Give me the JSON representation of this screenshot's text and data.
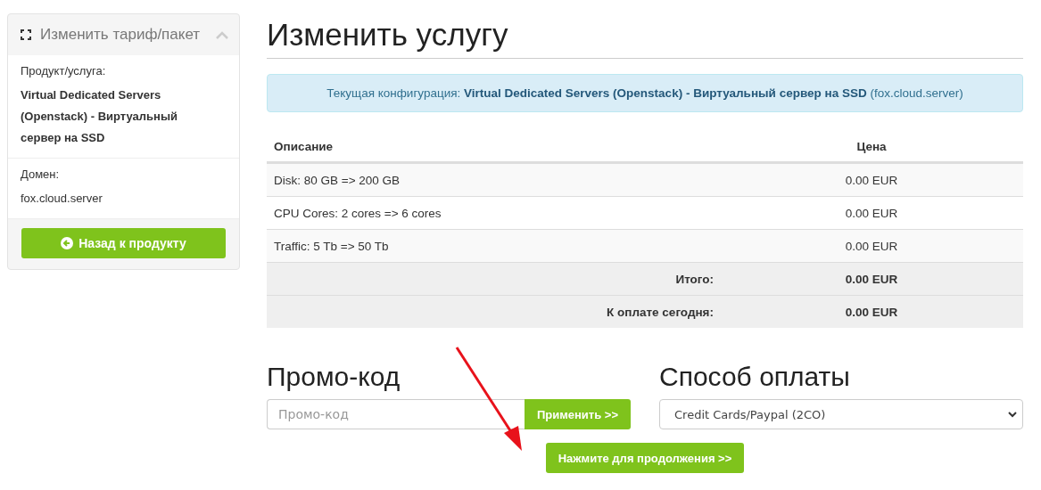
{
  "sidebar": {
    "title": "Изменить тариф/пакет",
    "expanded": true,
    "sections": [
      {
        "label": "Продукт/услуга:",
        "value": "Virtual Dedicated Servers (Openstack) - Виртуальный сервер на SSD",
        "bold": true
      },
      {
        "label": "Домен:",
        "value": "fox.cloud.server",
        "bold": false
      }
    ],
    "back_button": "Назад к продукту"
  },
  "title": "Изменить услугу",
  "alert": "Текущая конфигурация: **Virtual Dedicated Servers (Openstack) - Виртуальный сервер на SSD** (fox.cloud.server)",
  "table": {
    "columns": [
      "Описание",
      "Цена"
    ],
    "rows": [
      {
        "kind": "item",
        "description": "Disk: 80 GB => 200 GB",
        "price": "0.00 EUR"
      },
      {
        "kind": "item",
        "description": "CPU Cores: 2 cores => 6 cores",
        "price": "0.00 EUR"
      },
      {
        "kind": "item",
        "description": "Traffic: 5 Tb => 50 Tb",
        "price": "0.00 EUR"
      },
      {
        "kind": "total",
        "description": "Итого:",
        "price": "0.00 EUR"
      },
      {
        "kind": "total",
        "description": "К оплате сегодня:",
        "price": "0.00 EUR"
      }
    ]
  },
  "promo": {
    "heading": "Промо-код",
    "placeholder": "Промо-код",
    "button": "Применить >>"
  },
  "payment": {
    "heading": "Способ оплаты",
    "value": "Credit Cards/Paypal (2CO)"
  },
  "continue_button": "Нажмите для продолжения >>"
}
